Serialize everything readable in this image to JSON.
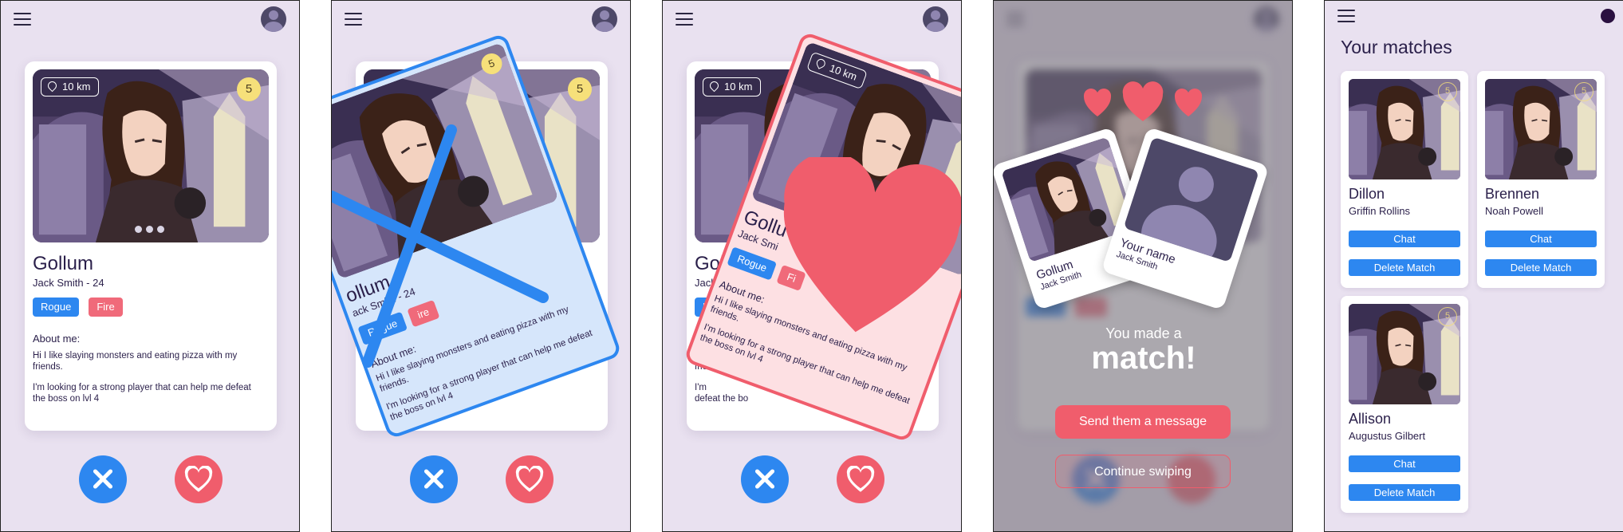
{
  "profile": {
    "distance": "10 km",
    "level": "5",
    "name": "Gollum",
    "subtitle": "Jack Smith - 24",
    "tags": [
      "Rogue",
      "Fire"
    ],
    "about_label": "About me:",
    "about": [
      "Hi I like slaying monsters and eating pizza with my friends.",
      "I'm looking for a strong player that can help me defeat the boss on lvl 4"
    ]
  },
  "swipe_left_card": {
    "name": "ollum",
    "subtitle": "ack Smith - 24",
    "tag_fire": "ire"
  },
  "swipe_right_card": {
    "name": "Gollu",
    "subtitle": "Jack Smi",
    "tag_fire": "Fi"
  },
  "behind_card": {
    "name": "Goll",
    "subtitle": "Jack",
    "tag_blue": "R",
    "about_label": "A",
    "line1": "Hi",
    "line2": "frie",
    "line3": "I'm",
    "line4": "defeat the bo"
  },
  "match_screen": {
    "heading_small": "You made a",
    "heading_big": "match!",
    "other_name": "Gollum",
    "other_sub": "Jack Smith",
    "your_name": "Your name",
    "your_sub": "Jack Smith",
    "primary_button": "Send them a message",
    "secondary_button": "Continue swiping"
  },
  "matches": {
    "title": "Your matches",
    "chat_label": "Chat",
    "delete_label": "Delete Match",
    "items": [
      {
        "name": "Dillon",
        "real_name": "Griffin Rollins",
        "level": "5"
      },
      {
        "name": "Brennen",
        "real_name": "Noah Powell",
        "level": "5"
      },
      {
        "name": "Allison",
        "real_name": "Augustus Gilbert",
        "level": "5"
      }
    ]
  },
  "colors": {
    "accent_blue": "#2d87f0",
    "accent_red": "#f05d6c",
    "background": "#e9e1f0"
  }
}
